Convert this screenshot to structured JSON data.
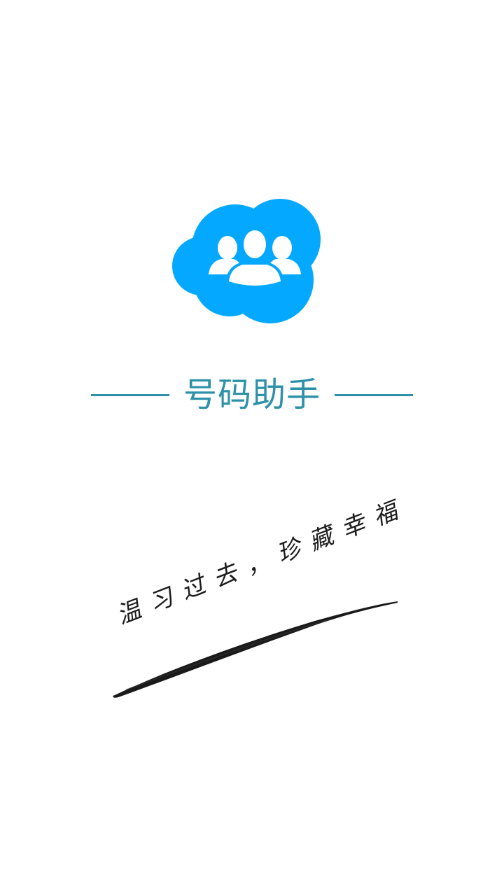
{
  "splash": {
    "logo_icon": "cloud-contacts-icon",
    "title": "号码助手",
    "slogan": "温习过去，珍藏幸福",
    "colors": {
      "cloud": "#05a8ff",
      "title": "#2e91a8",
      "rules": "#2e91a8",
      "slogan": "#1c1c1c"
    }
  }
}
